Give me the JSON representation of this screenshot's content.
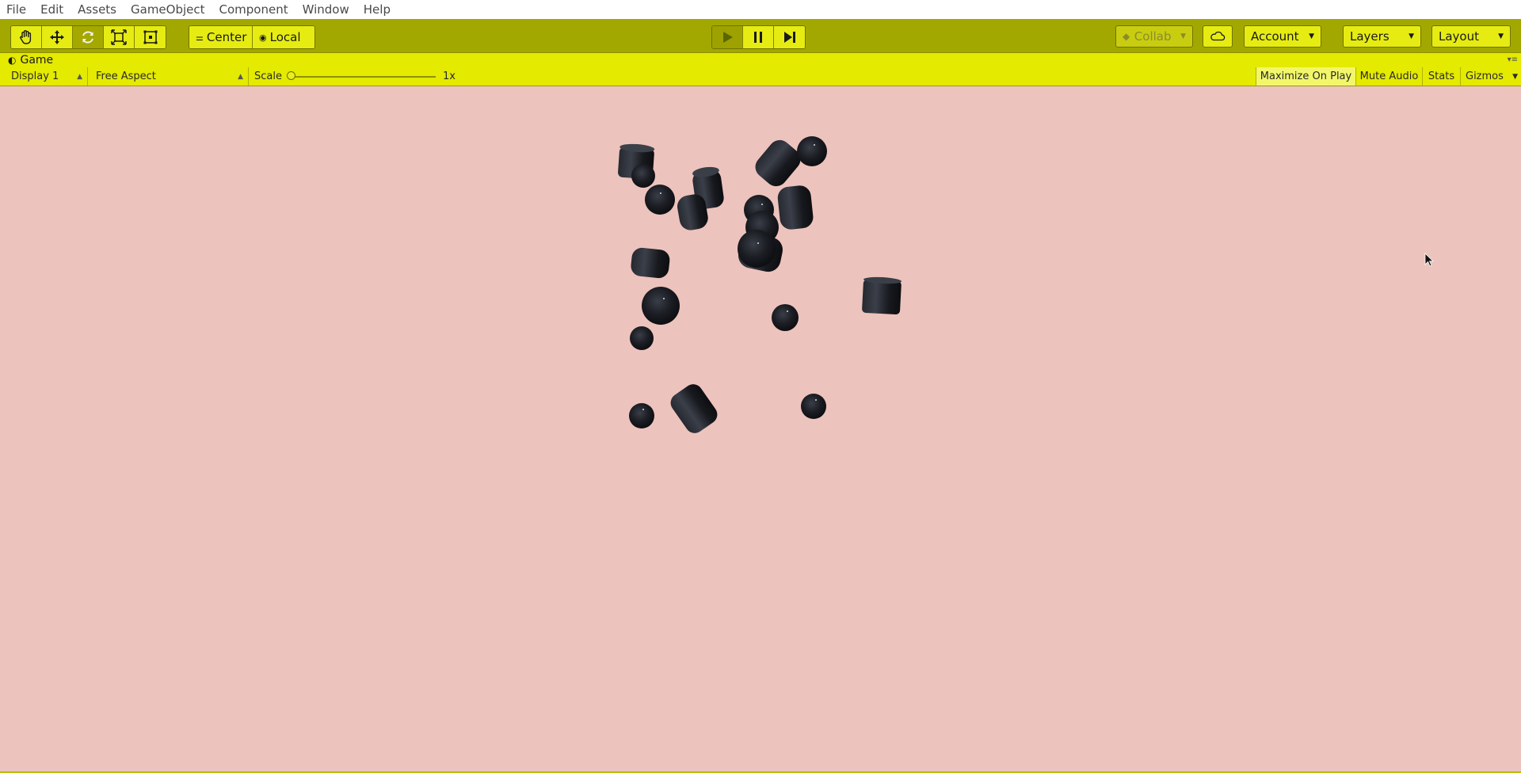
{
  "menubar": {
    "items": [
      {
        "label": "File"
      },
      {
        "label": "Edit"
      },
      {
        "label": "Assets"
      },
      {
        "label": "GameObject"
      },
      {
        "label": "Component"
      },
      {
        "label": "Window"
      },
      {
        "label": "Help"
      }
    ]
  },
  "toolbar": {
    "transform_tools": [
      "hand-icon",
      "move-icon",
      "rotate-icon",
      "scale-icon",
      "rect-icon"
    ],
    "active_tool": "rotate-icon",
    "pivot": {
      "center_label": "Center",
      "local_label": "Local"
    },
    "playback": {
      "play_active": true
    },
    "collab_label": "Collab",
    "account_label": "Account",
    "layers_label": "Layers",
    "layout_label": "Layout"
  },
  "game_tab": {
    "title": "Game"
  },
  "game_toolbar": {
    "display": "Display 1",
    "aspect": "Free Aspect",
    "scale_label": "Scale",
    "scale_value": "1x",
    "maximize_on_play": "Maximize On Play",
    "mute_audio": "Mute Audio",
    "stats": "Stats",
    "gizmos": "Gizmos"
  },
  "colors": {
    "toolbar_bg": "#a3a800",
    "panel_bg": "#e4ea00",
    "scene_bg": "#edc3bd",
    "object_fill": "#1a1c21"
  }
}
